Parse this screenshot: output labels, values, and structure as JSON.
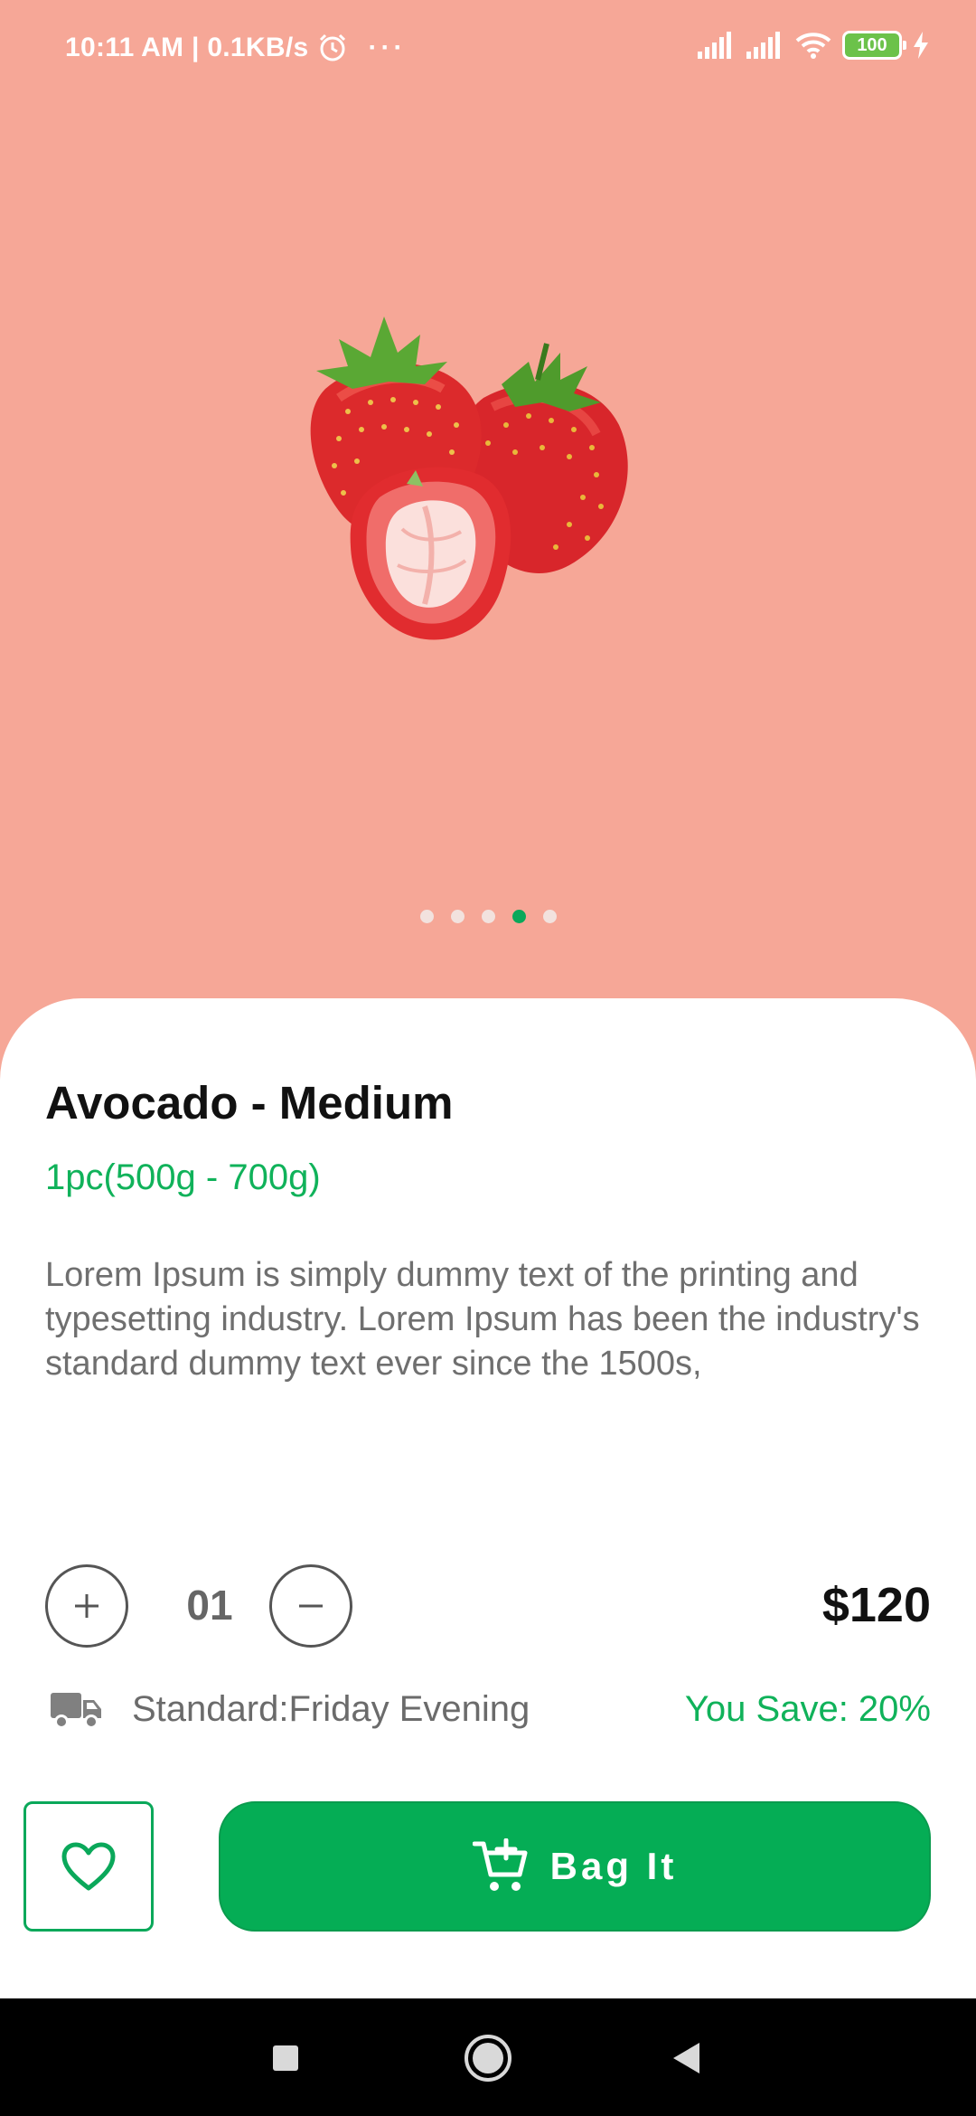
{
  "status_bar": {
    "time": "10:11 AM | 0.1KB/s",
    "overflow": "···",
    "battery_level": "100",
    "icons": [
      "alarm-icon",
      "signal-icon",
      "signal-icon",
      "wifi-icon",
      "battery-icon",
      "charging-icon"
    ]
  },
  "hero": {
    "image_icon": "strawberries-image",
    "background_color": "#f6a797",
    "pager": {
      "count": 5,
      "active_index": 3
    }
  },
  "product": {
    "title": "Avocado - Medium",
    "weight": "1pc(500g - 700g)",
    "description": "Lorem Ipsum is simply dummy text of the printing and typesetting industry. Lorem Ipsum has been the industry's standard dummy text ever since the 1500s,",
    "quantity": "01",
    "price": "$120",
    "delivery": "Standard:Friday Evening",
    "savings": "You Save: 20%"
  },
  "actions": {
    "favorite_icon": "heart-icon",
    "bag_label": "Bag It",
    "bag_icon": "add-to-cart-icon"
  },
  "colors": {
    "accent": "#05ad55",
    "accent_text": "#10b25a",
    "title": "#111111",
    "body_text": "#6f6f6f"
  },
  "nav_bar": {
    "buttons": [
      "recents-icon",
      "home-icon",
      "back-icon"
    ]
  }
}
